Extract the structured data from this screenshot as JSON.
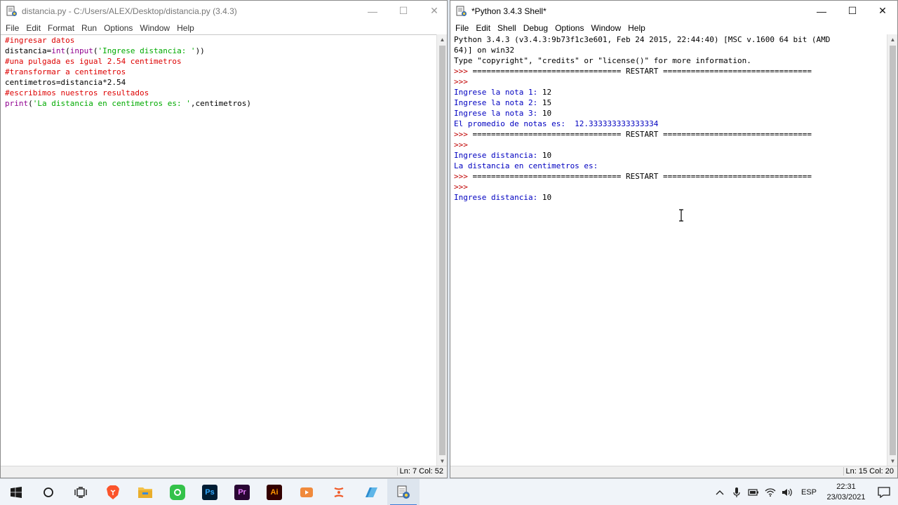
{
  "editor": {
    "title": "distancia.py - C:/Users/ALEX/Desktop/distancia.py (3.4.3)",
    "menu": [
      "File",
      "Edit",
      "Format",
      "Run",
      "Options",
      "Window",
      "Help"
    ],
    "lines": [
      [
        {
          "t": "#ingresar datos",
          "c": "comment"
        }
      ],
      [
        {
          "t": "distancia=",
          "c": "default"
        },
        {
          "t": "int",
          "c": "builtin"
        },
        {
          "t": "(",
          "c": "default"
        },
        {
          "t": "input",
          "c": "builtin"
        },
        {
          "t": "(",
          "c": "default"
        },
        {
          "t": "'Ingrese distancia: '",
          "c": "string"
        },
        {
          "t": "))",
          "c": "default"
        }
      ],
      [
        {
          "t": "#una pulgada es igual 2.54 centimetros",
          "c": "comment"
        }
      ],
      [
        {
          "t": "#transformar a centimetros",
          "c": "comment"
        }
      ],
      [
        {
          "t": "centimetros=distancia*2.54",
          "c": "default"
        }
      ],
      [
        {
          "t": "#escribimos nuestros resultados",
          "c": "comment"
        }
      ],
      [
        {
          "t": "print",
          "c": "builtin"
        },
        {
          "t": "(",
          "c": "default"
        },
        {
          "t": "'La distancia en centimetros es: '",
          "c": "string"
        },
        {
          "t": ",centimetros)",
          "c": "default"
        }
      ]
    ],
    "status": "Ln: 7  Col: 52"
  },
  "shell": {
    "title": "*Python 3.4.3 Shell*",
    "menu": [
      "File",
      "Edit",
      "Shell",
      "Debug",
      "Options",
      "Window",
      "Help"
    ],
    "lines": [
      [
        {
          "t": "Python 3.4.3 (v3.4.3:9b73f1c3e601, Feb 24 2015, 22:44:40) [MSC v.1600 64 bit (AMD",
          "c": "default"
        }
      ],
      [
        {
          "t": "64)] on win32",
          "c": "default"
        }
      ],
      [
        {
          "t": "Type \"copyright\", \"credits\" or \"license()\" for more information.",
          "c": "default"
        }
      ],
      [
        {
          "t": ">>> ",
          "c": "prompt"
        },
        {
          "t": "================================ RESTART ================================",
          "c": "default"
        }
      ],
      [
        {
          "t": ">>>",
          "c": "prompt"
        }
      ],
      [
        {
          "t": "Ingrese la nota 1: ",
          "c": "stdout"
        },
        {
          "t": "12",
          "c": "default"
        }
      ],
      [
        {
          "t": "Ingrese la nota 2: ",
          "c": "stdout"
        },
        {
          "t": "15",
          "c": "default"
        }
      ],
      [
        {
          "t": "Ingrese la nota 3: ",
          "c": "stdout"
        },
        {
          "t": "10",
          "c": "default"
        }
      ],
      [
        {
          "t": "El promedio de notas es:  12.333333333333334",
          "c": "stdout"
        }
      ],
      [
        {
          "t": ">>> ",
          "c": "prompt"
        },
        {
          "t": "================================ RESTART ================================",
          "c": "default"
        }
      ],
      [
        {
          "t": ">>>",
          "c": "prompt"
        }
      ],
      [
        {
          "t": "Ingrese distancia: ",
          "c": "stdout"
        },
        {
          "t": "10",
          "c": "default"
        }
      ],
      [
        {
          "t": "La distancia en centimetros es:",
          "c": "stdout"
        }
      ],
      [
        {
          "t": ">>> ",
          "c": "prompt"
        },
        {
          "t": "================================ RESTART ================================",
          "c": "default"
        }
      ],
      [
        {
          "t": ">>>",
          "c": "prompt"
        }
      ],
      [
        {
          "t": "Ingrese distancia: ",
          "c": "stdout"
        },
        {
          "t": "10",
          "c": "default"
        }
      ]
    ],
    "status": "Ln: 15  Col: 20"
  },
  "window_controls": {
    "minimize": "—",
    "maximize": "☐",
    "close": "✕"
  },
  "colors": {
    "comment": "#dd0000",
    "builtin": "#900090",
    "string": "#00aa00",
    "stdout": "#0000c0",
    "prompt": "#c00000"
  },
  "taskbar": {
    "apps": [
      {
        "name": "windows-start-icon"
      },
      {
        "name": "cortana-search-icon"
      },
      {
        "name": "task-view-icon"
      },
      {
        "name": "brave-browser-icon"
      },
      {
        "name": "file-explorer-icon"
      },
      {
        "name": "green-app-icon"
      },
      {
        "name": "photoshop-icon",
        "label": "Ps"
      },
      {
        "name": "premiere-icon",
        "label": "Pr"
      },
      {
        "name": "illustrator-icon",
        "label": "Ai"
      },
      {
        "name": "media-player-icon"
      },
      {
        "name": "git-app-icon"
      },
      {
        "name": "azure-data-studio-icon"
      },
      {
        "name": "python-idle-icon"
      }
    ],
    "language": "ESP",
    "time": "22:31",
    "date": "23/03/2021"
  }
}
